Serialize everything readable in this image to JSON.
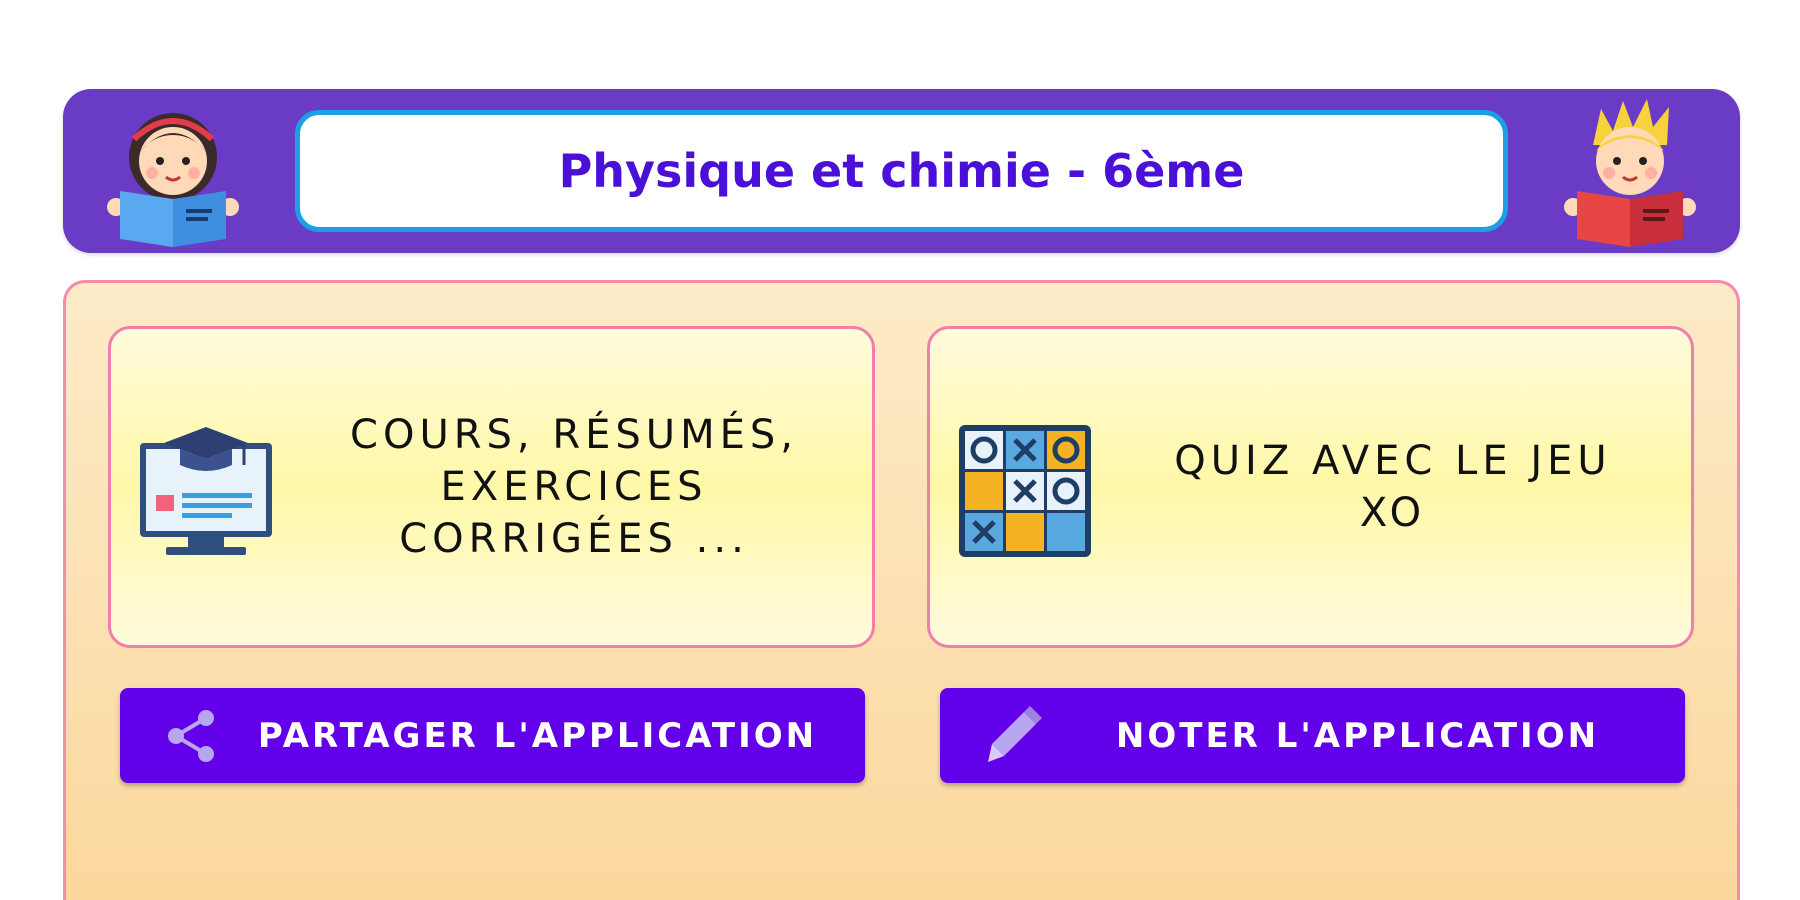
{
  "header": {
    "title": "Physique et chimie - 6ème",
    "left_icon": "girl-reading-icon",
    "right_icon": "boy-reading-icon"
  },
  "cards": [
    {
      "label": "COURS, RÉSUMÉS,\nEXERCICES\nCORRIGÉES ...",
      "icon": "graduation-monitor-icon"
    },
    {
      "label": "QUIZ AVEC LE JEU\nXO",
      "icon": "tic-tac-toe-icon"
    }
  ],
  "buttons": {
    "share_label": "PARTAGER L'APPLICATION",
    "share_icon": "share-icon",
    "rate_label": "NOTER L'APPLICATION",
    "rate_icon": "pencil-icon"
  },
  "colors": {
    "header_bg": "#6a3cc6",
    "title_text": "#4a10d8",
    "title_border": "#1aa0e6",
    "button_bg": "#6200ea",
    "card_border": "#f07fae",
    "panel_border": "#f28db0"
  }
}
